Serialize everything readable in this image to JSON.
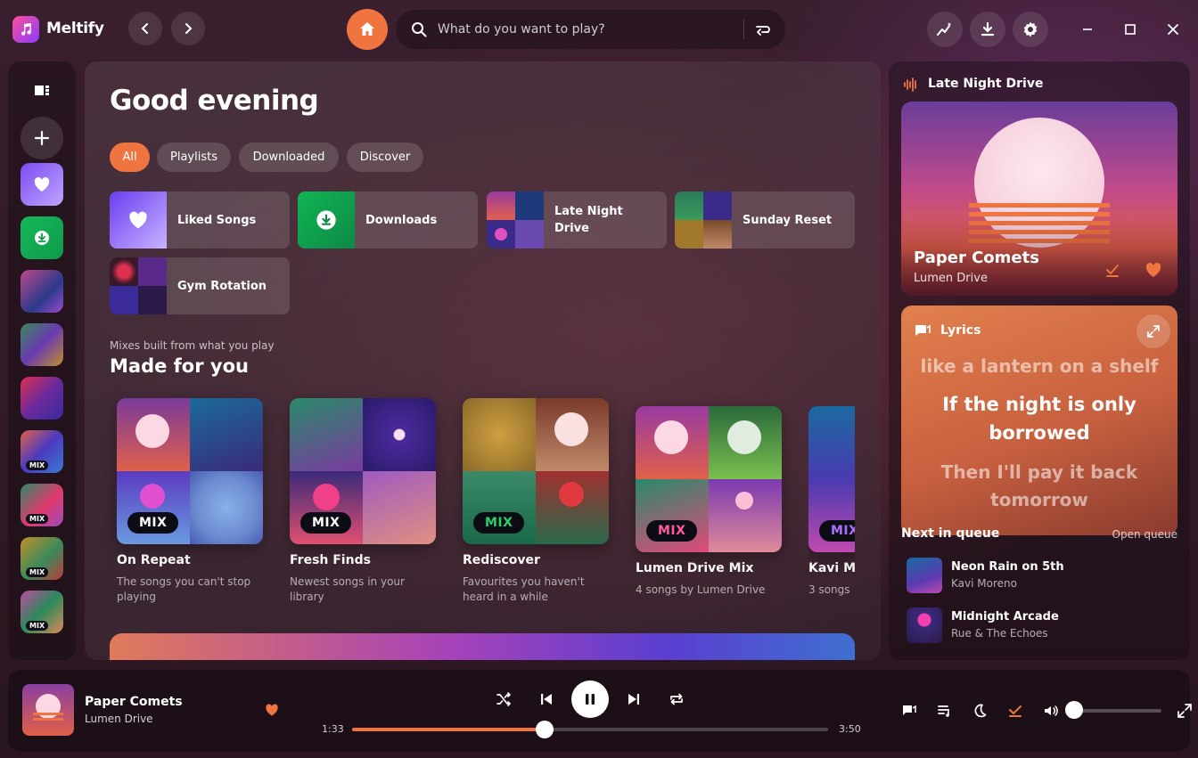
{
  "app": {
    "name": "Meltify"
  },
  "search": {
    "placeholder": "What do you want to play?"
  },
  "main": {
    "greeting": "Good evening",
    "filters": [
      "All",
      "Playlists",
      "Downloaded",
      "Discover"
    ],
    "tiles": [
      "Liked Songs",
      "Downloads",
      "Late Night Drive",
      "Sunday Reset",
      "Gym Rotation"
    ],
    "section_sub": "Mixes built from what you play",
    "section_title": "Made for you",
    "mix_badge": "MIX",
    "cards": [
      {
        "title": "On Repeat",
        "desc": "The songs you can't stop playing"
      },
      {
        "title": "Fresh Finds",
        "desc": "Newest songs in your library"
      },
      {
        "title": "Rediscover",
        "desc": "Favourites you haven't heard in a while"
      },
      {
        "title": "Lumen Drive Mix",
        "desc": "4 songs by Lumen Drive"
      },
      {
        "title": "Kavi Mo",
        "desc": "3 songs"
      }
    ]
  },
  "sidebar": {
    "mix_badge": "MIX"
  },
  "right": {
    "playlist": "Late Night Drive",
    "now_title": "Paper Comets",
    "now_artist": "Lumen Drive",
    "lyrics_title": "Lyrics",
    "lyrics": [
      "like a lantern on a shelf",
      "If the night is only",
      "borrowed",
      "Then I'll pay it back",
      "tomorrow"
    ],
    "queue_title": "Next in queue",
    "queue_open": "Open queue",
    "queue": [
      {
        "title": "Neon Rain on 5th",
        "artist": "Kavi Moreno"
      },
      {
        "title": "Midnight Arcade",
        "artist": "Rue & The Echoes"
      }
    ]
  },
  "player": {
    "title": "Paper Comets",
    "artist": "Lumen Drive",
    "current": "1:33",
    "total": "3:50",
    "progress": 0.405,
    "volume": 0.0
  },
  "colors": {
    "accent": "#f0743f"
  }
}
